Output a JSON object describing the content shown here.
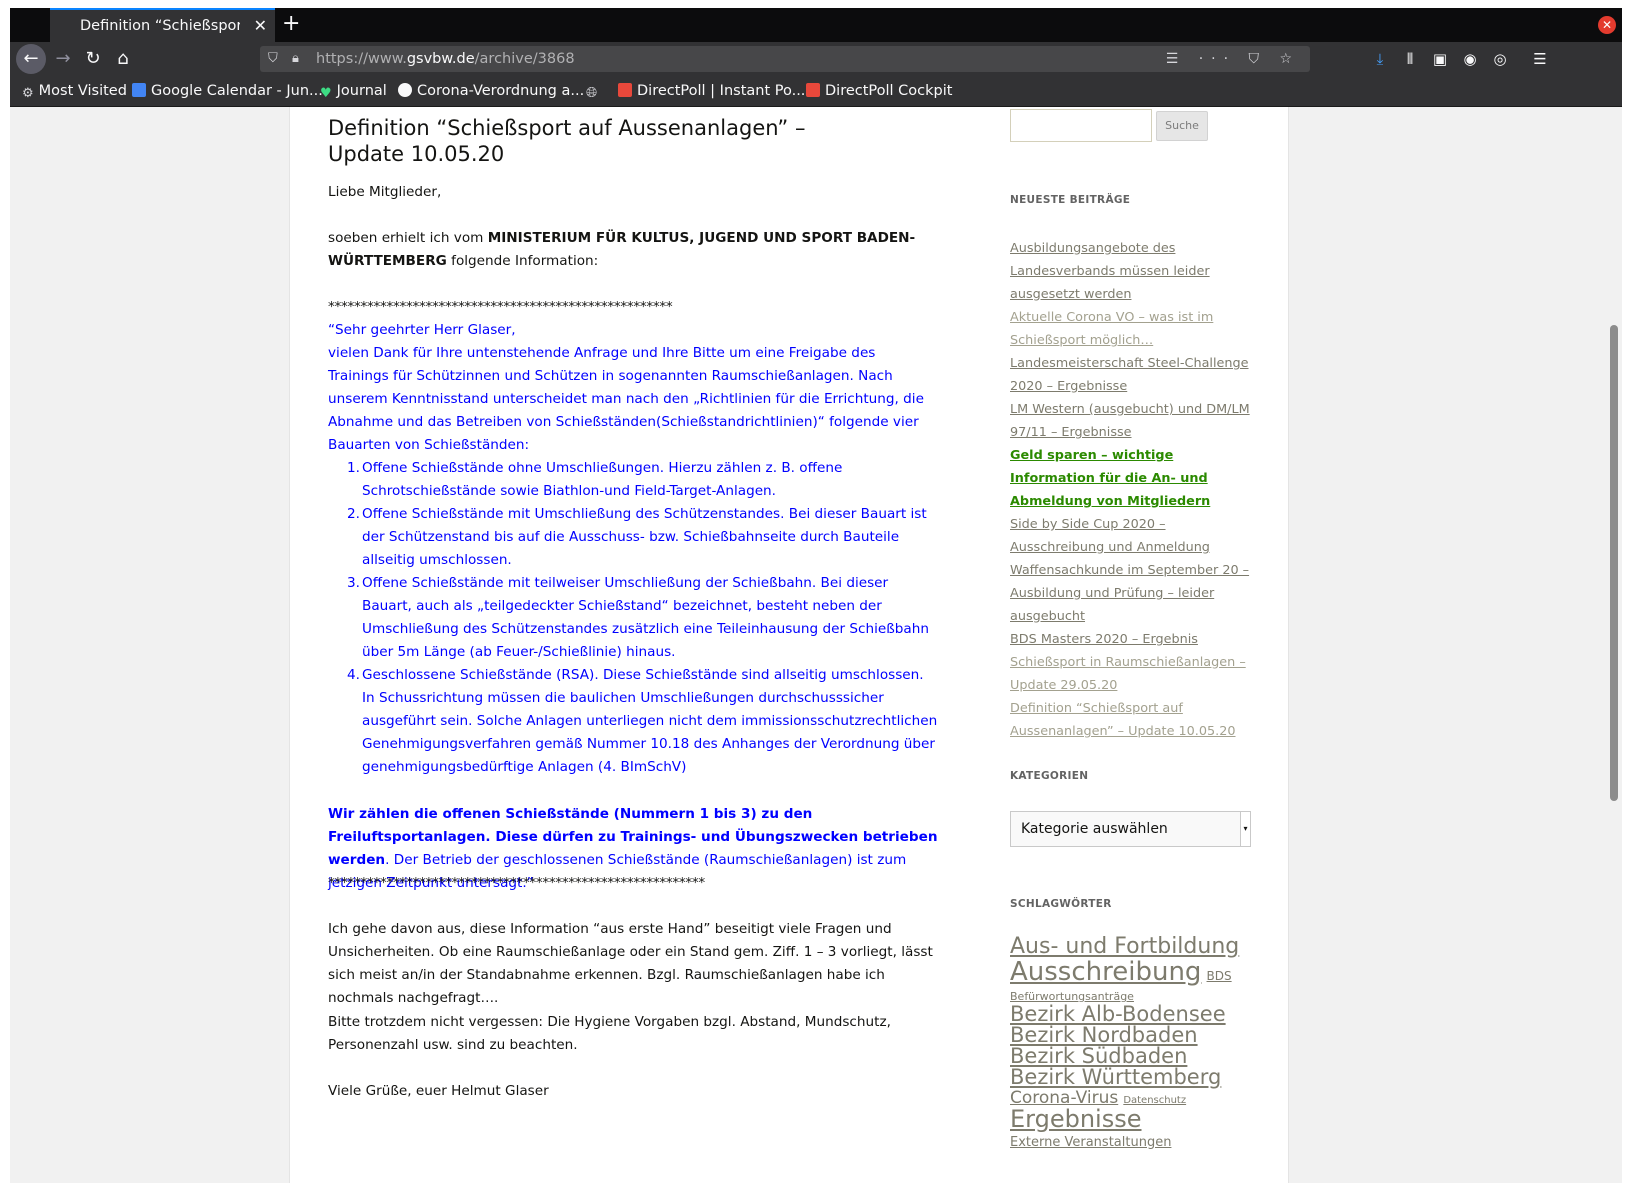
{
  "browser": {
    "tab_title": "Definition “Schießsport auf Aussenanlagen” – Update 10.05.20",
    "url_prefix": "https://www.",
    "url_host": "gsvbw.de",
    "url_path": "/archive/3868",
    "bookmarks": [
      {
        "label": "Most Visited",
        "icon": "gear-icon",
        "color": "#d7d7db"
      },
      {
        "label": "Google Calendar - Jun...",
        "icon": "calendar-icon",
        "color": "#4285f4"
      },
      {
        "label": "Journal",
        "icon": "heart-icon",
        "color": "#3ddc84"
      },
      {
        "label": "Corona-Verordnung a...",
        "icon": "site-icon",
        "color": "#f9f9fa"
      },
      {
        "label": "",
        "icon": "globe-icon",
        "color": "#d7d7db"
      },
      {
        "label": "DirectPoll | Instant Po...",
        "icon": "directpoll-icon",
        "color": "#e8483b"
      },
      {
        "label": "DirectPoll Cockpit",
        "icon": "directpoll-icon",
        "color": "#e8483b"
      }
    ]
  },
  "article": {
    "title": "Definition “Schießsport auf Aussenanlagen” – Update 10.05.20",
    "greeting": "Liebe Mitglieder,",
    "intro_pre": "soeben erhielt ich vom ",
    "intro_bold": "MINISTERIUM FÜR KULTUS, JUGEND UND SPORT BADEN-WÜRTTEMBERG",
    "intro_post": "  folgende Information:",
    "stars_top": "*****************************************************",
    "quote_salutation": "“Sehr geehrter Herr Glaser,",
    "quote_body": "vielen Dank für Ihre untenstehende Anfrage und Ihre Bitte um eine Freigabe des Trainings für Schützinnen und Schützen in sogenannten Raumschießanlagen. Nach unserem Kenntnisstand unterscheidet man nach den „Richtlinien für die Errichtung, die Abnahme und das Betreiben von Schießständen(Schießstandrichtlinien)“ folgende vier Bauarten von Schießständen:",
    "list": [
      {
        "num": "1.",
        "text": "Offene Schießstände ohne Umschließungen. Hierzu zählen z. B. offene Schrotschießständ­e sowie Biathlon-und Field-Target-Anlagen."
      },
      {
        "num": "2.",
        "text": "Offene Schießstände mit Umschließung des Schützenstandes. Bei dieser Bauart ist der Schützenstand bis auf die Ausschuss- bzw. Schießbahnseite durch Bauteile allseitig umschlossen."
      },
      {
        "num": "3.",
        "text": "Offene Schießstände mit teilweiser Umschließung der Schießbahn. Bei dieser Bauart, auch als „teilgedeckter Schießstand“ bezeichnet, besteht neben der Umschließung des Schützenstandes zusätzlich eine Teileinhausung der Schießbahn über 5m Länge (ab Feuer-/Schießlinie) hinaus."
      },
      {
        "num": "4.",
        "text": "Geschlossene Schießstände (RSA). Diese Schießstände sind allseitig umschlossen. In Schussrichtung müssen die baulichen Umschließungen durchschusssicher ausgeführt sein. Solche Anlagen unterliegen nicht dem immissionsschutzrechtlichen Genehmigungsverfahren gemäß Nummer 10.18 des Anhanges der Verordnung über genehmigungsbedürftige Anlagen (4. BImSchV)"
      }
    ],
    "conclusion_bold": "Wir zählen die offenen Schießstände (Nummern 1 bis 3) zu den Freiluftsportanlagen. Diese dürfen zu Trainings- und Übungszwecken betrieben werden",
    "conclusion_rest": ". Der Betrieb der geschlossenen Schießstände (Raumschießanlagen) ist zum jetzigen Zeitpunkt untersagt.”",
    "stars_bottom": "**********************************************************",
    "para1": "Ich gehe davon aus, diese Information “aus erste Hand” beseitigt viele Fragen und Unsicherheiten. Ob eine Raumschießanlage oder ein Stand gem. Ziff. 1 – 3 vorliegt, lässt sich meist an/in der Standabnahme erkennen.  Bzgl. Raumschießanlagen  habe ich nochmals nachgefragt….",
    "para2": "Bitte trotzdem nicht vergessen: Die Hygiene Vorgaben bzgl. Abstand, Mundschutz, Personenzahl usw. sind zu beachten.",
    "signoff": "Viele Grüße, euer Helmut Glaser"
  },
  "sidebar": {
    "search_button": "Suche",
    "recent_title": "NEUESTE BEITRÄGE",
    "recent": [
      {
        "text": "Ausbildungsangebote des Landesverbands müssen leider ausgesetzt werden",
        "style": "normal"
      },
      {
        "text": "Aktuelle Corona VO – was ist im Schießsport möglich…",
        "style": "visited"
      },
      {
        "text": "Landesmeisterschaft Steel-Challenge 2020 – Ergebnisse",
        "style": "normal"
      },
      {
        "text": "LM Western (ausgebucht) und DM/LM 97/11 – Ergebnisse",
        "style": "normal"
      },
      {
        "text": "Geld sparen – wichtige Information für die An- und Abmeldung von Mitgliedern",
        "style": "hot"
      },
      {
        "text": "Side by Side Cup 2020 – Ausschreibung und Anmeldung",
        "style": "normal"
      },
      {
        "text": "Waffensachkunde im September 20 – Ausbildung und Prüfung – leider ausgebucht",
        "style": "normal"
      },
      {
        "text": "BDS Masters 2020 – Ergebnis",
        "style": "normal"
      },
      {
        "text": "Schießsport in Raumschießanlagen – Update 29.05.20",
        "style": "visited"
      },
      {
        "text": "Definition “Schießsport auf Aussenanlagen” – Update 10.05.20",
        "style": "visited"
      }
    ],
    "categories_title": "KATEGORIEN",
    "category_select": "Kategorie auswählen",
    "tags_title": "SCHLAGWÖRTER",
    "tags": [
      {
        "text": "Aus- und Fortbildung",
        "size": 22
      },
      {
        "text": "Ausschreibung",
        "size": 26
      },
      {
        "text": "BDS",
        "size": 12
      },
      {
        "text": "Befürwortungsanträge",
        "size": 11
      },
      {
        "text": "Bezirk Alb-Bodensee",
        "size": 21
      },
      {
        "text": "Bezirk Nordbaden",
        "size": 21
      },
      {
        "text": "Bezirk Südbaden",
        "size": 21
      },
      {
        "text": "Bezirk Württemberg",
        "size": 21
      },
      {
        "text": "Corona-Virus",
        "size": 17
      },
      {
        "text": "Datenschutz",
        "size": 10
      },
      {
        "text": "Ergebnisse",
        "size": 24
      },
      {
        "text": "Externe Veranstaltungen",
        "size": 13
      }
    ]
  }
}
